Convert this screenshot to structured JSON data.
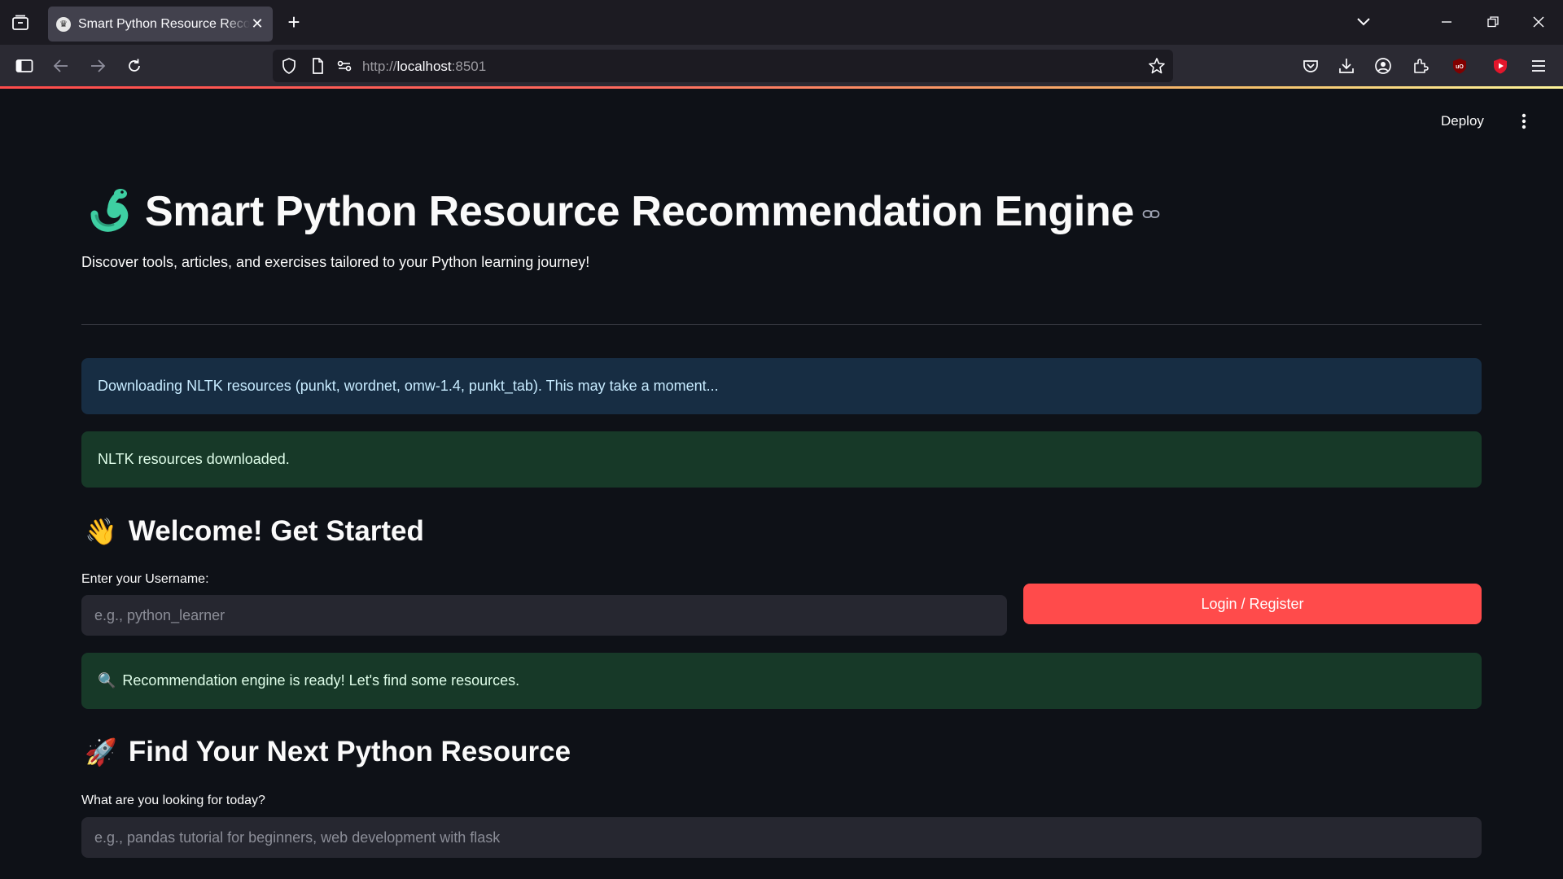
{
  "browser": {
    "tab": {
      "title": "Smart Python Resource Recommendation Engine",
      "close": "✕"
    },
    "new_tab": "+",
    "url": {
      "scheme": "http://",
      "host": "localhost",
      "port": ":8501"
    }
  },
  "toolbar": {
    "deploy_label": "Deploy"
  },
  "header": {
    "title": "Smart Python Resource Recommendation Engine",
    "subtitle": "Discover tools, articles, and exercises tailored to your Python learning journey!"
  },
  "alerts": {
    "nltk_downloading": "Downloading NLTK resources (punkt, wordnet, omw-1.4, punkt_tab). This may take a moment...",
    "nltk_done": "NLTK resources downloaded.",
    "engine_ready_emoji": "🔍",
    "engine_ready": "Recommendation engine is ready! Let's find some resources."
  },
  "welcome": {
    "emoji": "👋",
    "heading": "Welcome! Get Started",
    "username_label": "Enter your Username:",
    "username_placeholder": "e.g., python_learner",
    "login_button": "Login / Register"
  },
  "search": {
    "emoji": "🚀",
    "heading": "Find Your Next Python Resource",
    "query_label": "What are you looking for today?",
    "query_placeholder": "e.g., pandas tutorial for beginners, web development with flask"
  },
  "colors": {
    "app_background": "#0e1117",
    "primary": "#ff4b4b",
    "info_bg": "#172d43",
    "success_bg": "#173928",
    "input_bg": "#262730"
  }
}
